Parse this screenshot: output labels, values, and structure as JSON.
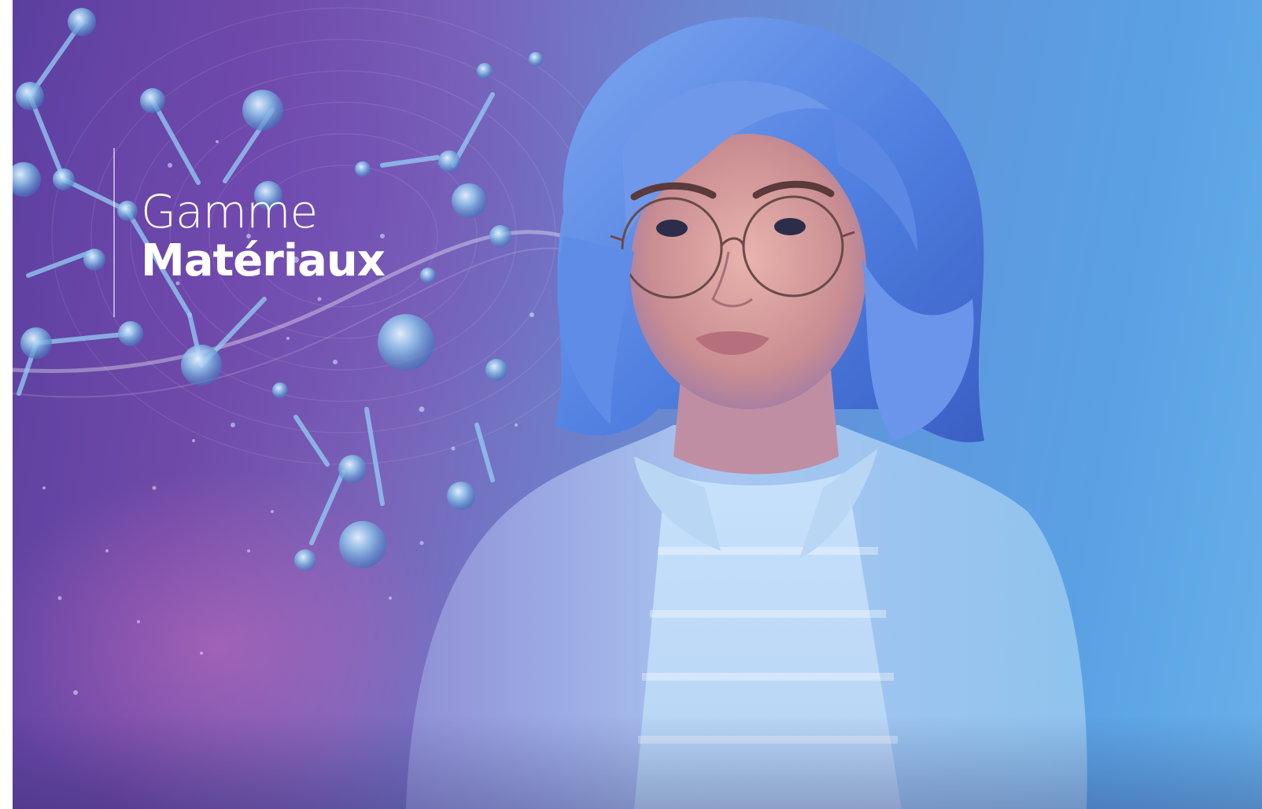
{
  "hero": {
    "title_light": "Gamme",
    "title_bold": "Matériaux"
  },
  "colors": {
    "left_purple": "#5a3f9f",
    "magenta_glow": "#c46ebe",
    "right_blue": "#67b0ea",
    "text": "#ffffff",
    "hair": "#5b8ee8",
    "jacket": "#a8cff2"
  },
  "artwork": {
    "left": "molecule-network-illustration",
    "right": "portrait-woman-blue-hair-glasses"
  }
}
